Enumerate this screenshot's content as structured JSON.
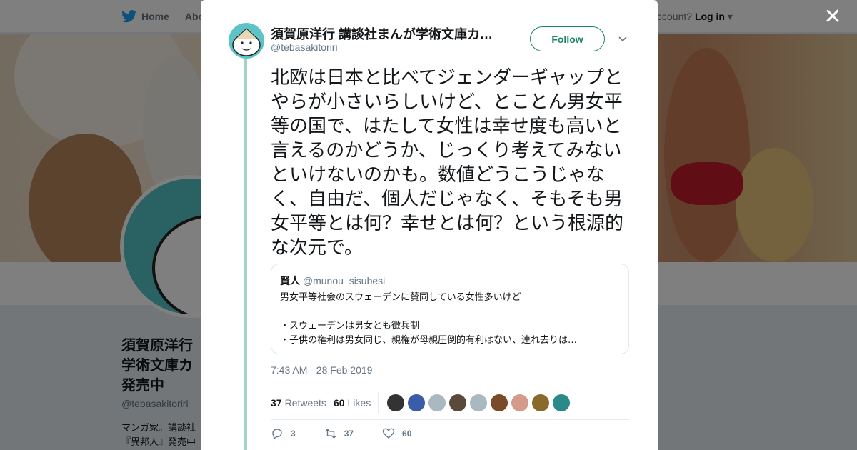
{
  "background": {
    "nav": {
      "home_label": "Home",
      "about_label": "Abo"
    },
    "login": {
      "prefix": "ccount?",
      "login_label": "Log in"
    },
    "profile": {
      "name": "須賀原洋行 学術文庫カ 発売中",
      "handle": "@tebasakitoriri",
      "bio": "マンガ家。講談社 『異邦人』発売中"
    }
  },
  "modal": {
    "author": {
      "name": "須賀原洋行 講談社まんが学術文庫カ…",
      "handle": "@tebasakitoriri"
    },
    "follow_label": "Follow",
    "tweet_text": "北欧は日本と比べてジェンダーギャップとやらが小さいらしいけど、とことん男女平等の国で、はたして女性は幸せ度も高いと言えるのかどうか、じっくり考えてみないといけないのかも。数値どうこうじゃなく、自由だ、個人だじゃなく、そもそも男女平等とは何？幸せとは何？という根源的な次元で。",
    "quote": {
      "name": "賢人",
      "handle": "@munou_sisubesi",
      "text": "男女平等社会のスウェーデンに賛同している女性多いけど\n\n・スウェーデンは男女とも徴兵制\n・子供の権利は男女同じ、親権が母親圧倒的有利はない、連れ去りは…"
    },
    "timestamp": "7:43 AM - 28 Feb 2019",
    "stats": {
      "retweets_count": "37",
      "retweets_label": "Retweets",
      "likes_count": "60",
      "likes_label": "Likes"
    },
    "actions": {
      "reply_count": "3",
      "retweet_count": "37",
      "like_count": "60"
    },
    "liker_colors": [
      "#333333",
      "#3b5ca8",
      "#aab8c2",
      "#5a4a3a",
      "#aab8c2",
      "#7a4a2a",
      "#d49a8a",
      "#8a6a2a",
      "#2a8a8a"
    ],
    "colors": {
      "accent": "#1b8363",
      "thread_line": "#a3d3c5"
    }
  }
}
